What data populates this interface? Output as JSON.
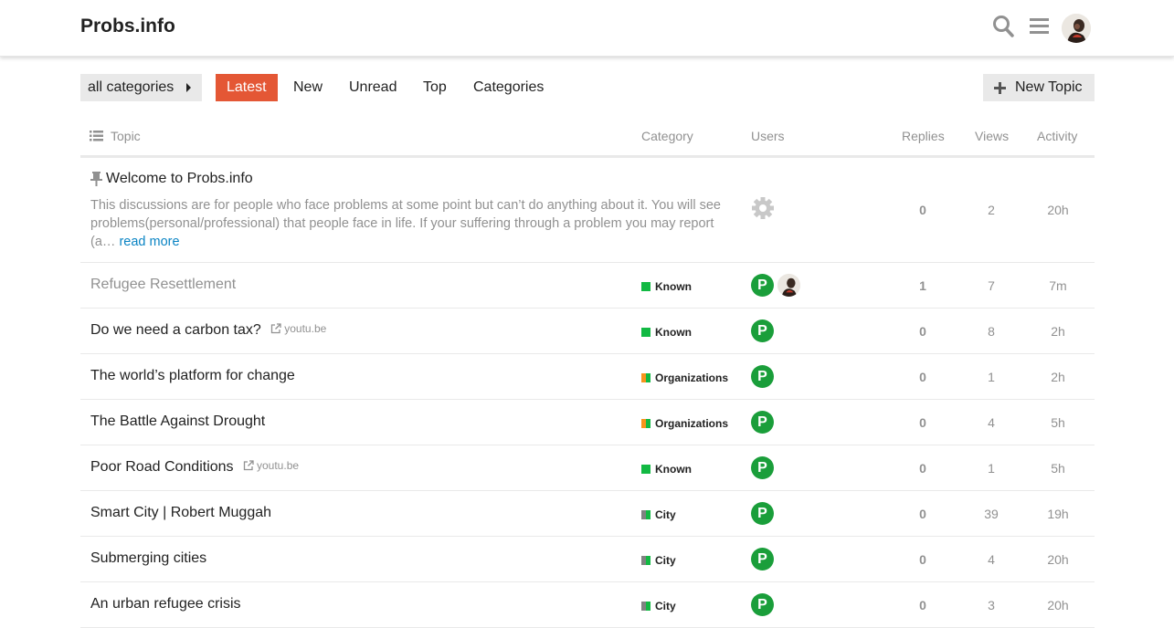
{
  "header": {
    "site_title": "Probs.info",
    "icons": [
      "search-icon",
      "hamburger-menu-icon",
      "user-avatar"
    ]
  },
  "nav": {
    "category_dropdown": "all categories",
    "items": [
      {
        "label": "Latest",
        "active": true
      },
      {
        "label": "New",
        "active": false
      },
      {
        "label": "Unread",
        "active": false
      },
      {
        "label": "Top",
        "active": false
      },
      {
        "label": "Categories",
        "active": false
      }
    ],
    "new_topic": "New Topic"
  },
  "columns": {
    "topic": "Topic",
    "category": "Category",
    "users": "Users",
    "replies": "Replies",
    "views": "Views",
    "activity": "Activity"
  },
  "colors": {
    "accent": "#e45735",
    "known": "#12b943",
    "organizations": "#f7941d",
    "city": "#808281",
    "avatar_green": "#1a9e3a",
    "link": "#0a84c4"
  },
  "pinned": {
    "title": "Welcome to Probs.info",
    "excerpt": "This discussions are for people who face problems at some point but can’t do anything about it. You will see problems(personal/professional) that people face in life. If your suffering through a problem you may report (a…",
    "read_more": "read more",
    "replies": "0",
    "views": "2",
    "activity": "20h"
  },
  "topics": [
    {
      "title": "Refugee Resettlement",
      "domain": "",
      "category": "Known",
      "replies": "1",
      "views": "7",
      "activity": "7m"
    },
    {
      "title": "Do we need a carbon tax?",
      "domain": "youtu.be",
      "category": "Known",
      "replies": "0",
      "views": "8",
      "activity": "2h"
    },
    {
      "title": "The world’s platform for change",
      "domain": "",
      "category": "Organizations",
      "replies": "0",
      "views": "1",
      "activity": "2h"
    },
    {
      "title": "The Battle Against Drought",
      "domain": "",
      "category": "Organizations",
      "replies": "0",
      "views": "4",
      "activity": "5h"
    },
    {
      "title": "Poor Road Conditions",
      "domain": "youtu.be",
      "category": "Known",
      "replies": "0",
      "views": "1",
      "activity": "5h"
    },
    {
      "title": "Smart City | Robert Muggah",
      "domain": "",
      "category": "City",
      "replies": "0",
      "views": "39",
      "activity": "19h"
    },
    {
      "title": "Submerging cities",
      "domain": "",
      "category": "City",
      "replies": "0",
      "views": "4",
      "activity": "20h"
    },
    {
      "title": "An urban refugee crisis",
      "domain": "",
      "category": "City",
      "replies": "0",
      "views": "3",
      "activity": "20h"
    }
  ],
  "avatar_letter": "P"
}
